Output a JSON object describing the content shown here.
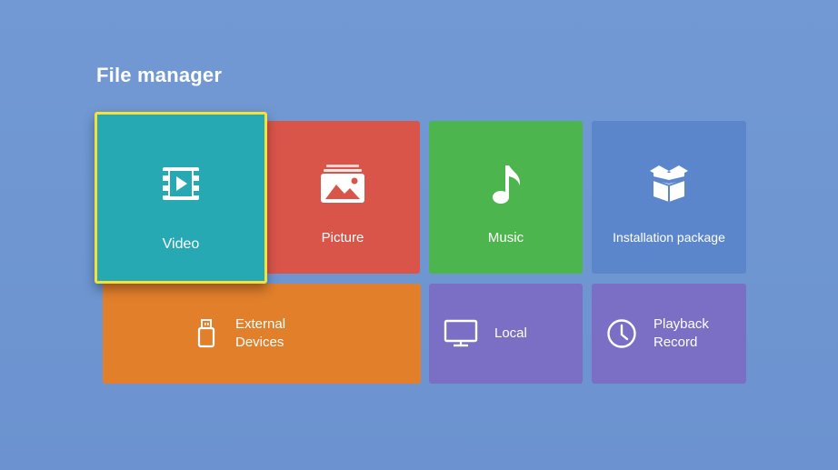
{
  "header": {
    "title": "File manager"
  },
  "tiles": {
    "video": {
      "label": "Video",
      "icon": "video-icon",
      "color": "#27a9b3",
      "focused": true
    },
    "picture": {
      "label": "Picture",
      "icon": "picture-icon",
      "color": "#d9554a"
    },
    "music": {
      "label": "Music",
      "icon": "music-note-icon",
      "color": "#4cb54e"
    },
    "package": {
      "label": "Installation package",
      "icon": "package-box-icon",
      "color": "#5b86cb"
    },
    "external": {
      "label_line1": "External",
      "label_line2": "Devices",
      "icon": "usb-drive-icon",
      "color": "#e17f2b"
    },
    "local": {
      "label": "Local",
      "icon": "monitor-icon",
      "color": "#7a6fc4"
    },
    "playback": {
      "label_line1": "Playback",
      "label_line2": "Record",
      "icon": "clock-icon",
      "color": "#7a6fc4"
    }
  },
  "colors": {
    "background": "#6e95d0",
    "focus_border": "#f4e23c"
  }
}
